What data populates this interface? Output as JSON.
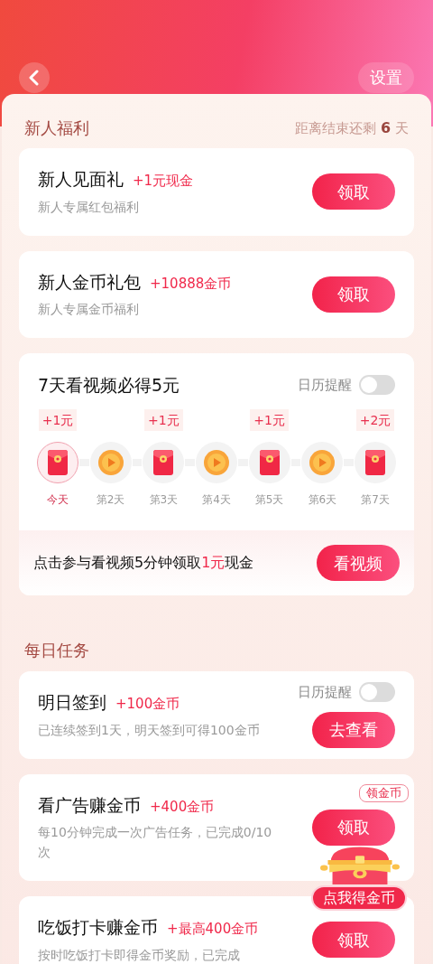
{
  "header": {
    "settings": "设置"
  },
  "newbie": {
    "title": "新人福利",
    "countdown": "距离结束还剩 **6** 天",
    "cards": [
      {
        "title": "新人见面礼",
        "reward": "+1元现金",
        "subtitle": "新人专属红包福利",
        "button": "领取"
      },
      {
        "title": "新人金币礼包",
        "reward": "+10888金币",
        "subtitle": "新人专属金币福利",
        "button": "领取"
      }
    ]
  },
  "video_task": {
    "title": "7天看视频必得5元",
    "reminder": {
      "label": "日历提醒",
      "on": false
    },
    "days": [
      {
        "bonus": "+1元",
        "kind": "redpacket",
        "label": "今天",
        "selected": true
      },
      {
        "kind": "coin",
        "label": "第2天",
        "selected": false
      },
      {
        "bonus": "+1元",
        "kind": "redpacket",
        "label": "第3天",
        "selected": false
      },
      {
        "kind": "coin",
        "label": "第4天",
        "selected": false
      },
      {
        "bonus": "+1元",
        "kind": "redpacket",
        "label": "第5天",
        "selected": false
      },
      {
        "kind": "coin",
        "label": "第6天",
        "selected": false
      },
      {
        "bonus": "+2元",
        "kind": "redpacket",
        "label": "第7天",
        "selected": false
      }
    ],
    "footer": "点击参与看视频5分钟领取**1元**现金",
    "button": "看视频"
  },
  "daily": {
    "title": "每日任务",
    "tasks": [
      {
        "title": "明日签到",
        "reward": "+100金币",
        "subtitle": "已连续签到1天，明天签到可得100金币",
        "button": "去查看",
        "reminder": {
          "label": "日历提醒",
          "on": false
        }
      },
      {
        "title": "看广告赚金币",
        "reward": "+400金币",
        "subtitle": "每10分钟完成一次广告任务，已完成0/10次",
        "button": "领取"
      },
      {
        "title": "吃饭打卡赚金币",
        "reward": "+最高400金币",
        "subtitle": "按时吃饭打卡即得金币奖励，已完成",
        "button": "领取"
      }
    ]
  },
  "floating": {
    "tag": "领金币",
    "button": "点我得金币"
  }
}
